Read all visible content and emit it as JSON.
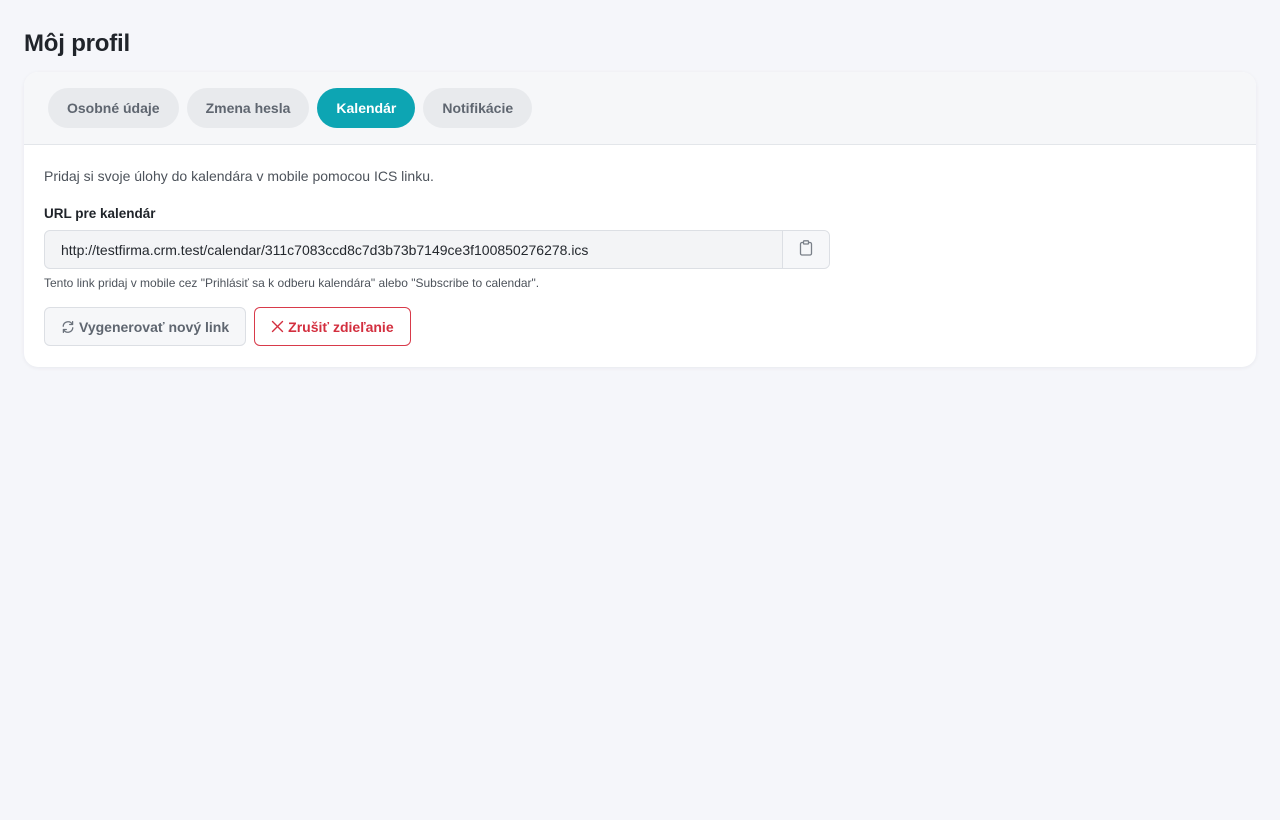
{
  "page": {
    "title": "Môj profil"
  },
  "tabs": [
    {
      "label": "Osobné údaje",
      "active": false
    },
    {
      "label": "Zmena hesla",
      "active": false
    },
    {
      "label": "Kalendár",
      "active": true
    },
    {
      "label": "Notifikácie",
      "active": false
    }
  ],
  "calendar": {
    "description": "Pridaj si svoje úlohy do kalendára v mobile pomocou ICS linku.",
    "url_label": "URL pre kalendár",
    "url_value": "http://testfirma.crm.test/calendar/311c7083ccd8c7d3b73b7149ce3f100850276278.ics",
    "hint": "Tento link pridaj v mobile cez \"Prihlásiť sa k odberu kalendára\" alebo \"Subscribe to calendar\".",
    "regenerate_label": "Vygenerovať nový link",
    "cancel_label": "Zrušiť zdieľanie"
  },
  "icons": {
    "copy": "clipboard-icon",
    "regenerate": "refresh-icon",
    "cancel": "close-icon"
  },
  "colors": {
    "accent": "#0da5b3",
    "danger": "#d32f3f",
    "background": "#f5f6fa"
  }
}
